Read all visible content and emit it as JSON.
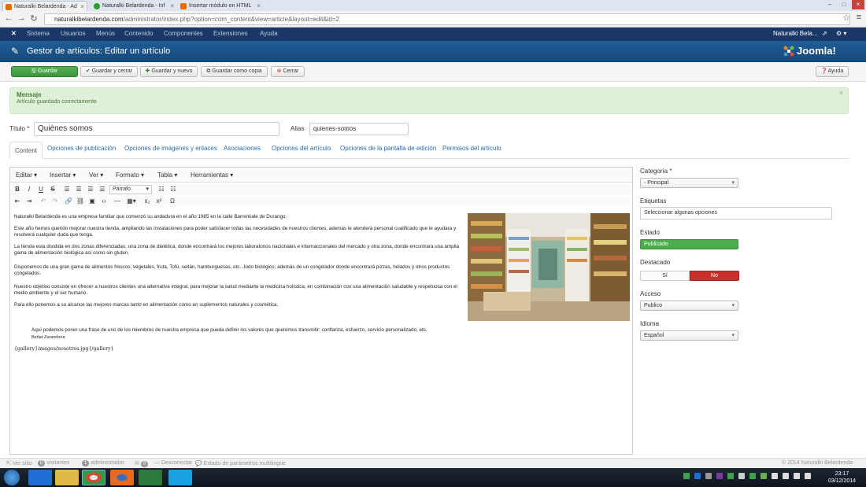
{
  "browser": {
    "tabs": [
      {
        "title": "Naturalki Belardenda - Ad",
        "favicon_color": "#ea6b00"
      },
      {
        "title": "Naturalki Belardenda - Inf",
        "favicon_color": "#2e9b2e"
      },
      {
        "title": "Insertar módulo en HTML",
        "favicon_color": "#ea6b00"
      }
    ],
    "url_host": "naturalkibelardenda.com",
    "url_path": "/administrator/index.php?option=com_content&view=article&layout=edit&id=2"
  },
  "topnav": {
    "items": [
      "Sistema",
      "Usuarios",
      "Menús",
      "Contenido",
      "Componentes",
      "Extensiones",
      "Ayuda"
    ],
    "user": "Naturalki Bela..."
  },
  "header": {
    "title": "Gestor de artículos: Editar un artículo",
    "logo": "Joomla!"
  },
  "toolbar": {
    "save": "Guardar",
    "save_close": "Guardar y cerrar",
    "save_new": "Guardar y nuevo",
    "save_copy": "Guardar como copia",
    "close": "Cerrar",
    "help": "Ayuda"
  },
  "message": {
    "heading": "Mensaje",
    "text": "Artículo guardado correctamente"
  },
  "form": {
    "title_label": "Título *",
    "title_value": "Quiénes somos",
    "alias_label": "Alias",
    "alias_value": "quienes-somos"
  },
  "tabs": [
    "Content",
    "Opciones de publicación",
    "Opciones de imágenes y enlaces",
    "Asociaciones",
    "Opciones del artículo",
    "Opciones de la pantalla de edición",
    "Permisos del artículo"
  ],
  "editor": {
    "menus": [
      "Editar",
      "Insertar",
      "Ver",
      "Formato",
      "Tabla",
      "Herramientas"
    ],
    "paragraph_select": "Párrafo",
    "paragraphs": [
      "Naturalki Belardenda es una empresa familiar que comenzó su andadura  en el año 1985 en la calle Barrenkale de Durango.",
      "Este año hemos querido mejorar nuestra tienda, ampliando las instalaciones para poder satisfacer todas las necesidades de nuestros clientes, además le atenderá personal cualificado que le ayudara y resolverá cualquier duda que tenga.",
      "La tienda esta dividida en dos zonas diferenciadas; una zona de dietética, donde encontrará los mejores laboratorios nacionales e internaccionales del mercado y otra  zona, donde encontrara una amplia gama de alimentación biológica así  como sin gluten.",
      "Disponemos de una gran gama de alimentos frescos; vegetales, fruta, Tofú, seitán, hamburguesas, etc...todo biológico; además de un congelador donde encontrará pizzas, helados y otros productos congelados.",
      "Nuestro objetivo consiste en ofrecer a nuestros clientes una alternativa integral, para mejorar la salud mediante la medicina holística, en combinación con una alimentación saludable y respetuosa con el medio ambiente y el ser humano.",
      "Para ello ponemos a su alcance las mejores marcas tanto en alimentación como en suplementos naturales y cosmética."
    ],
    "quote": "Aquí podemos poner una frase de uno de los miembros de nuestra empresa que pueda definir los valores que queremos transmitir: confianza, esfuerzo, servicio personalizado, etc.",
    "quote_author": "Beñat Zarandona",
    "gallery_tag": "{gallery}images/nosotros.jpg{/gallery}"
  },
  "sidebar": {
    "category_label": "Categoría *",
    "category_value": "- Principal",
    "tags_label": "Etiquetas",
    "tags_placeholder": "Seleccionar algunas opciones",
    "status_label": "Estado",
    "status_value": "Publicado",
    "featured_label": "Destacado",
    "featured_yes": "Sí",
    "featured_no": "No",
    "access_label": "Acceso",
    "access_value": "Publico",
    "language_label": "Idioma",
    "language_value": "Español"
  },
  "statusbar": {
    "view_site": "Ver sitio",
    "visitors_count": "0",
    "visitors_label": "visitantes",
    "admins_count": "1",
    "admins_label": "administrador",
    "messages_count": "0",
    "logout": "Desconectar",
    "multilang": "Estado de parámetros multilingüe",
    "copyright": "© 2014 Naturalki Belardenda"
  },
  "taskbar": {
    "time": "23:17",
    "date": "03/12/2014"
  }
}
